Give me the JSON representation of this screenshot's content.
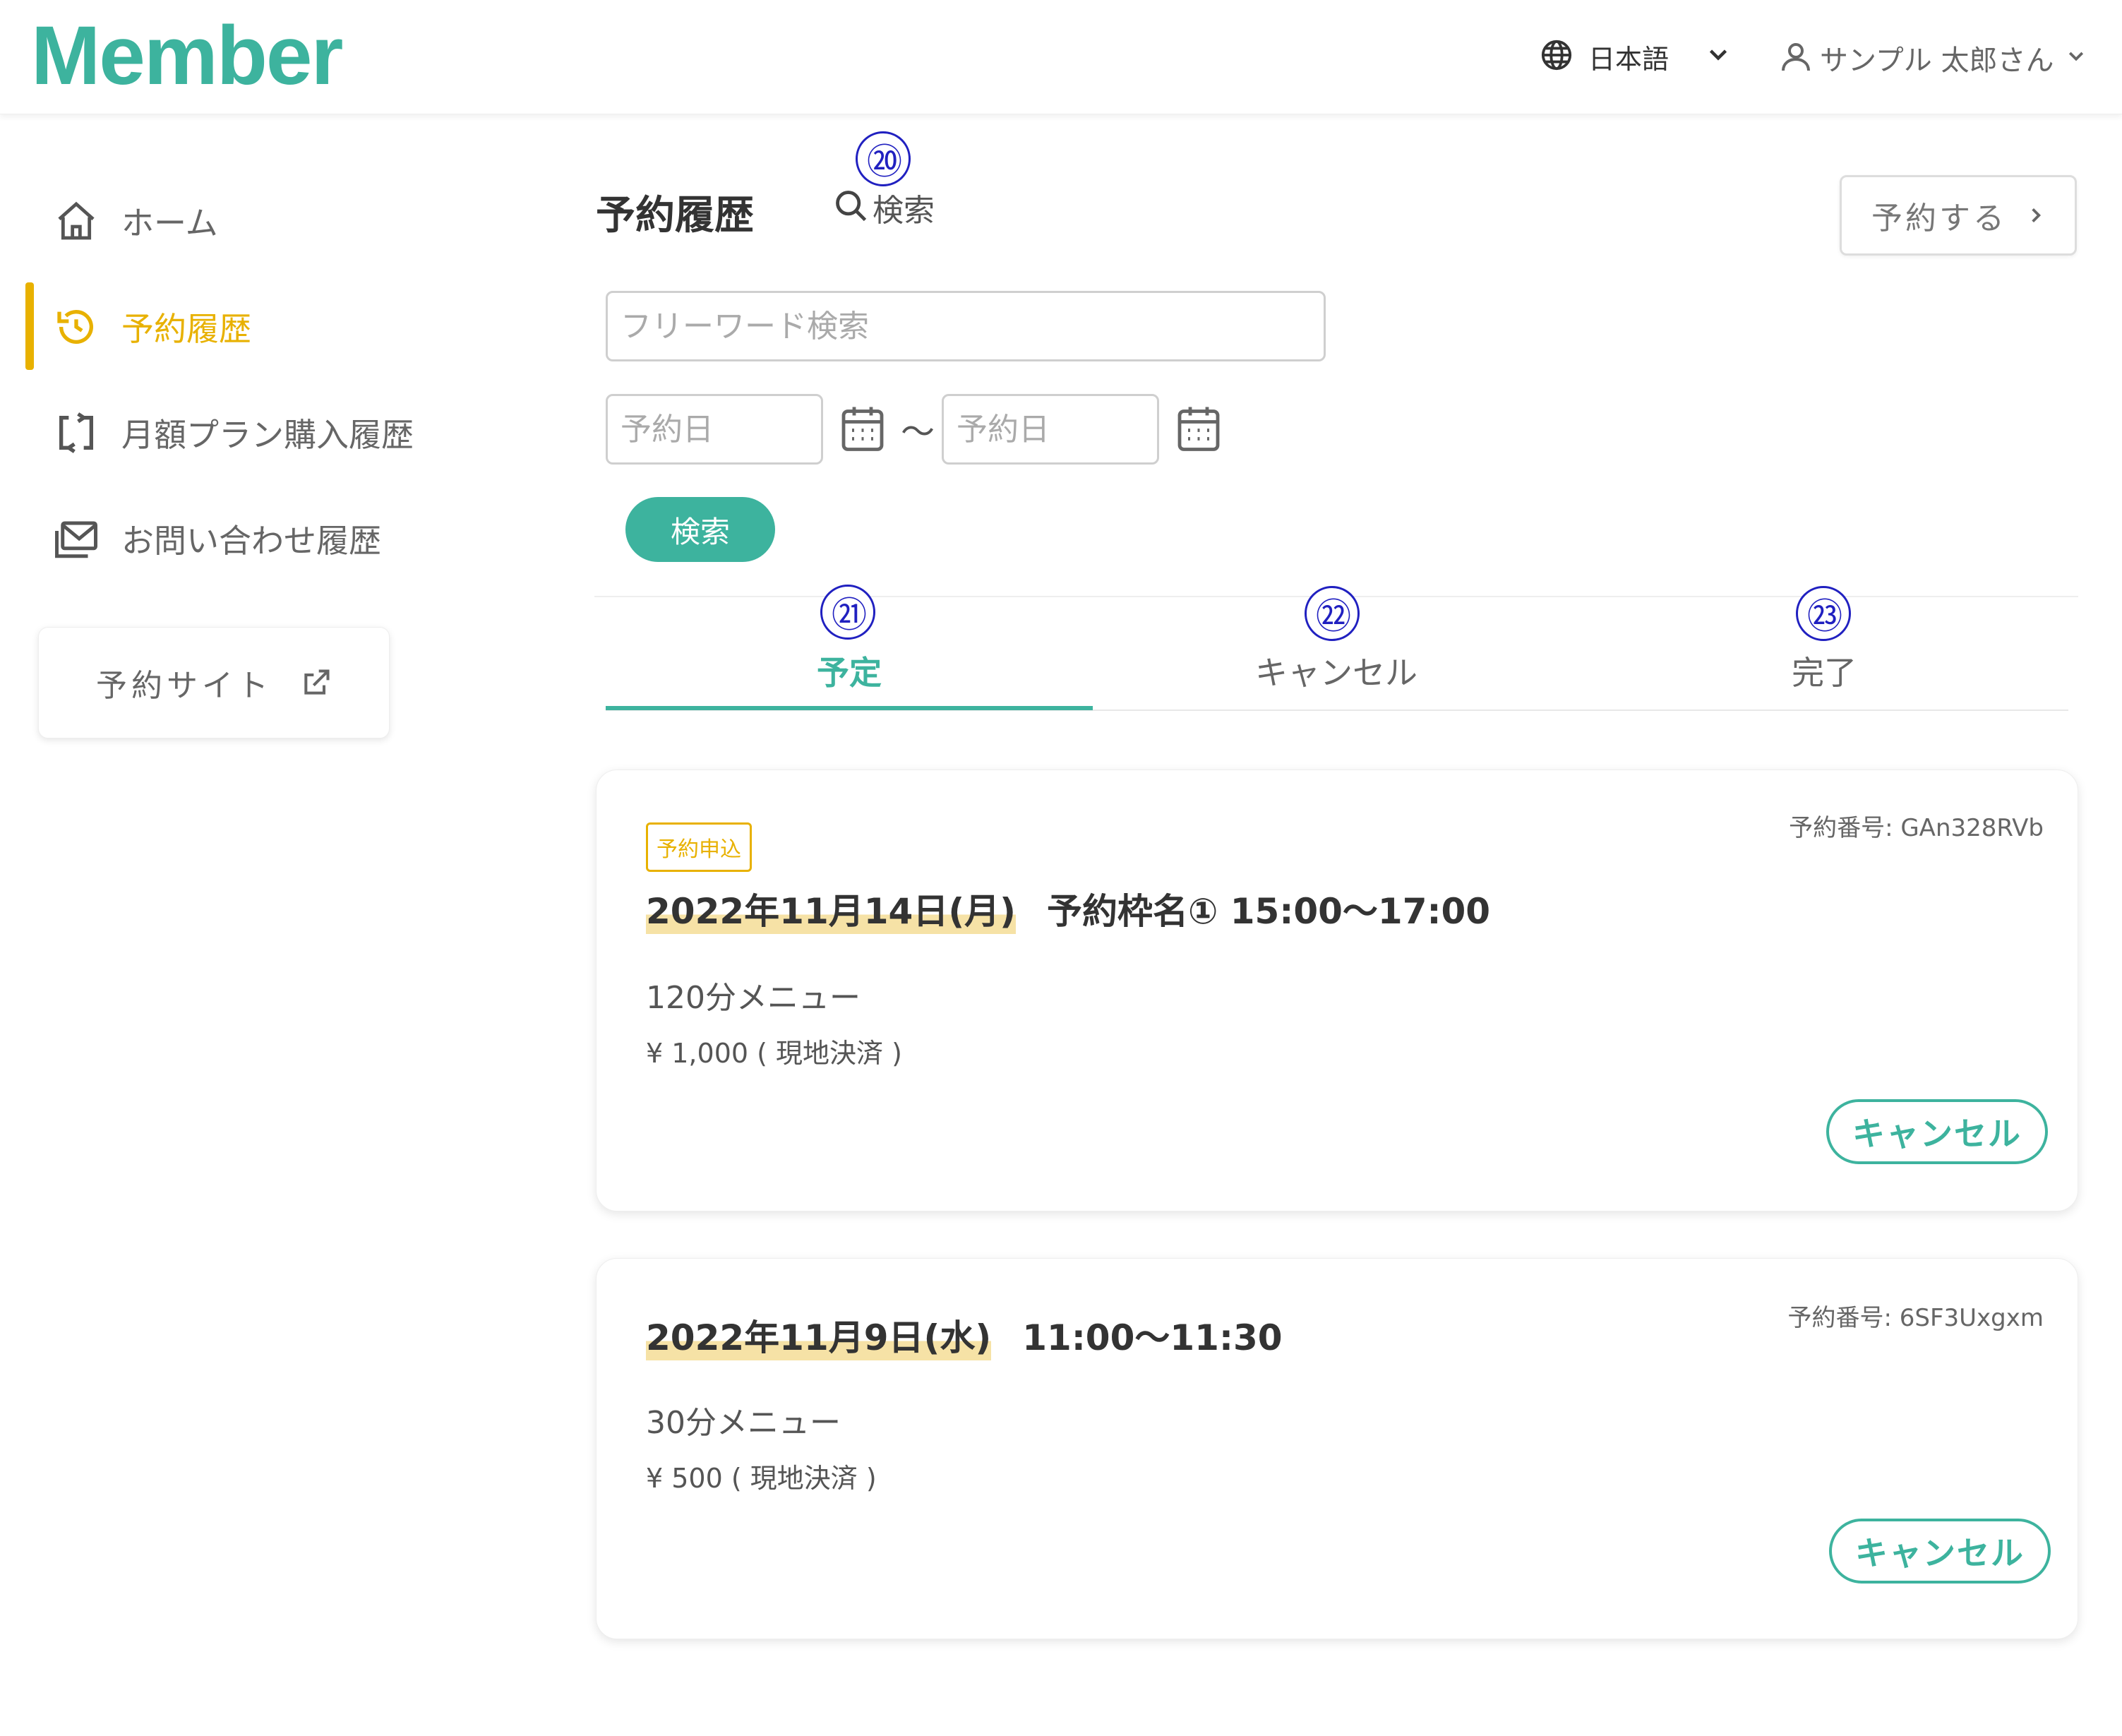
{
  "header": {
    "logo": "Member",
    "language": "日本語",
    "user_name": "サンプル 太郎さん"
  },
  "sidebar": {
    "items": [
      {
        "label": "ホーム",
        "icon": "home-icon"
      },
      {
        "label": "予約履歴",
        "icon": "history-icon",
        "active": true
      },
      {
        "label": "月額プラン購入履歴",
        "icon": "repeat-icon"
      },
      {
        "label": "お問い合わせ履歴",
        "icon": "mail-icon"
      }
    ],
    "site_button": "予約サイト"
  },
  "main": {
    "title": "予約履歴",
    "search_toggle": "検索",
    "reserve_button": "予約する",
    "search": {
      "free_word_placeholder": "フリーワード検索",
      "date_from_placeholder": "予約日",
      "date_to_placeholder": "予約日",
      "separator": "〜",
      "button": "検索"
    },
    "tabs": [
      {
        "label": "予定",
        "active": true
      },
      {
        "label": "キャンセル"
      },
      {
        "label": "完了"
      }
    ],
    "callouts": [
      "⑳",
      "㉑",
      "㉒",
      "㉓"
    ],
    "reservations": [
      {
        "badge": "予約申込",
        "reservation_no": "予約番号: GAn328RVb",
        "date": "2022年11月14日(月)",
        "slot": "予約枠名① 15:00〜17:00",
        "menu": "120分メニュー",
        "price": "¥ 1,000 ( 現地決済 )",
        "cancel": "キャンセル"
      },
      {
        "reservation_no": "予約番号: 6SF3Uxgxm",
        "date": "2022年11月9日(水)",
        "slot": "11:00〜11:30",
        "menu": "30分メニュー",
        "price": "¥ 500 ( 現地決済 )",
        "cancel": "キャンセル"
      }
    ]
  },
  "colors": {
    "accent": "#3db39e",
    "active": "#e8b100",
    "highlight": "#f6e2a6",
    "callout": "#2020c0"
  }
}
